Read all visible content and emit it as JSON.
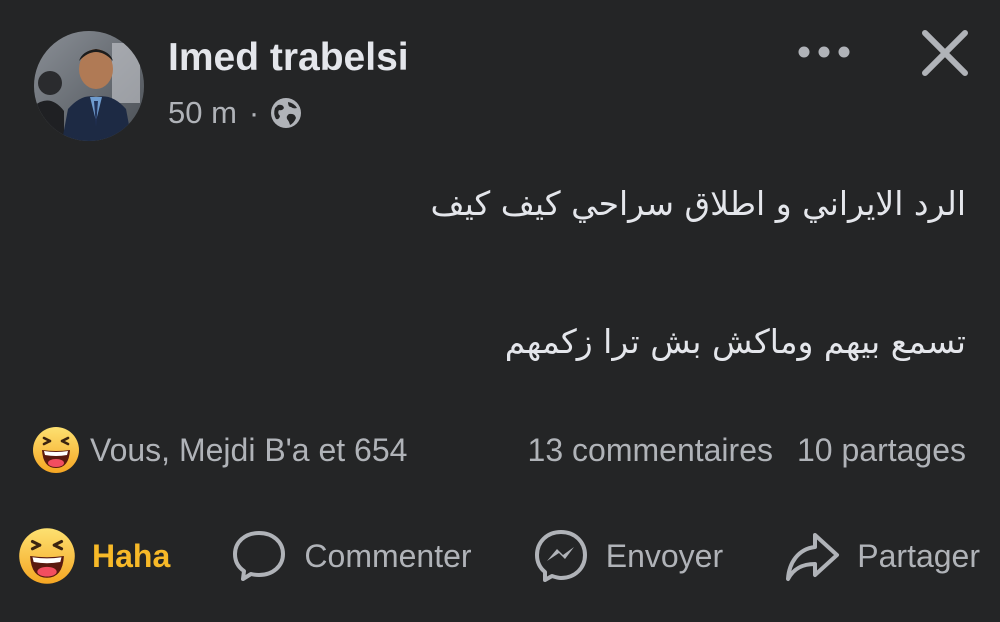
{
  "post": {
    "author": "Imed trabelsi",
    "time": "50 m",
    "separator": "·",
    "privacy_icon": "globe-icon",
    "lines": [
      "الرد الايراني و اطلاق سراحي كيف كيف",
      "تسمع بيهم وماكش بش ترا زكمهم"
    ]
  },
  "stats": {
    "reactions_text": "Vous, Mejdi B'a et 654",
    "reaction_icon": "haha-emoji-icon",
    "comments": "13 commentaires",
    "shares": "10 partages"
  },
  "actions": {
    "react_label": "Haha",
    "comment_label": "Commenter",
    "send_label": "Envoyer",
    "share_label": "Partager"
  },
  "colors": {
    "background": "#242526",
    "primary_text": "#e4e6eb",
    "secondary_text": "#b0b3b8",
    "haha_accent": "#f7b928"
  }
}
